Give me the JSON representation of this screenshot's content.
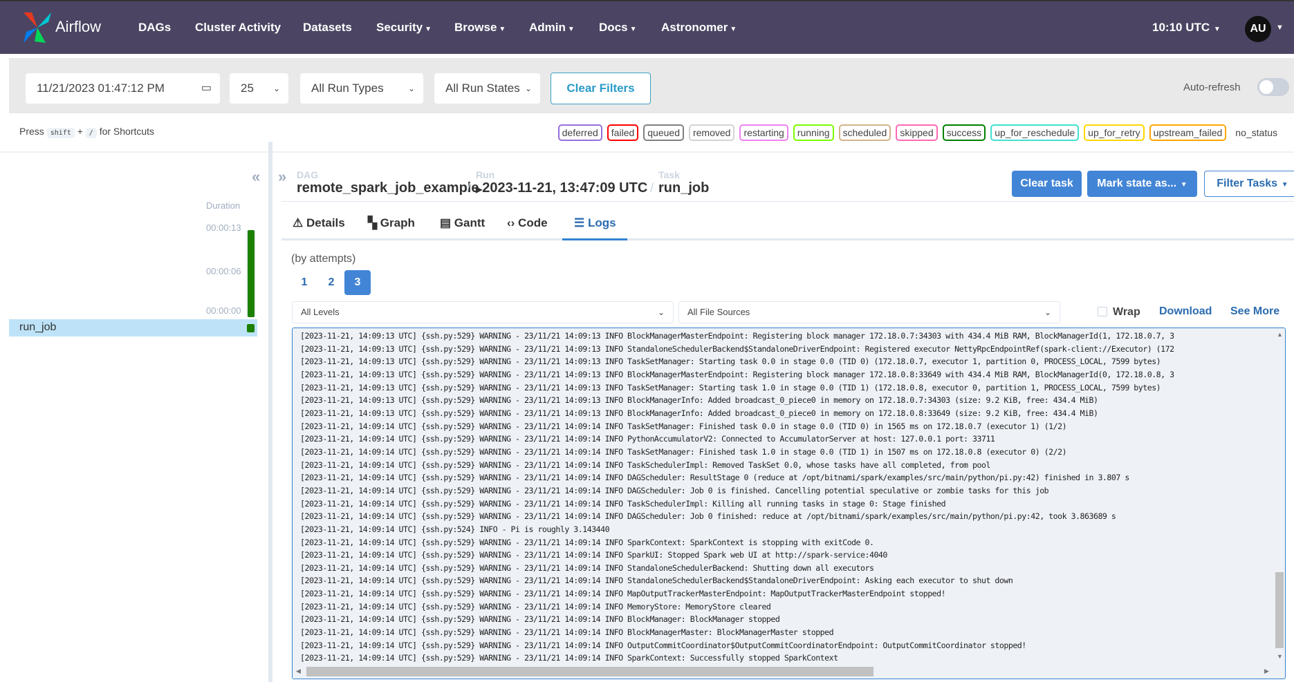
{
  "nav": {
    "brand": "Airflow",
    "items": [
      {
        "label": "DAGs",
        "dropdown": false
      },
      {
        "label": "Cluster Activity",
        "dropdown": false
      },
      {
        "label": "Datasets",
        "dropdown": false
      },
      {
        "label": "Security",
        "dropdown": true
      },
      {
        "label": "Browse",
        "dropdown": true
      },
      {
        "label": "Admin",
        "dropdown": true
      },
      {
        "label": "Docs",
        "dropdown": true
      },
      {
        "label": "Astronomer",
        "dropdown": true
      }
    ],
    "time": "10:10 UTC",
    "avatar": "AU"
  },
  "filters": {
    "datetime": "11/21/2023 01:47:12 PM",
    "limit": "25",
    "run_type": "All Run Types",
    "run_state": "All Run States",
    "clear": "Clear Filters",
    "auto_refresh": "Auto-refresh",
    "auto_refresh_on": false
  },
  "shortcuts": {
    "press": "Press",
    "key1": "shift",
    "plus": "+",
    "key2": "/",
    "suffix": "for Shortcuts"
  },
  "legend": [
    {
      "label": "deferred",
      "color": "#9370db"
    },
    {
      "label": "failed",
      "color": "#ff0000"
    },
    {
      "label": "queued",
      "color": "#808080"
    },
    {
      "label": "removed",
      "color": "#d3d3d3"
    },
    {
      "label": "restarting",
      "color": "#ee82ee"
    },
    {
      "label": "running",
      "color": "#7cfc00"
    },
    {
      "label": "scheduled",
      "color": "#d2b48c"
    },
    {
      "label": "skipped",
      "color": "#ff69b4"
    },
    {
      "label": "success",
      "color": "#008000"
    },
    {
      "label": "up_for_reschedule",
      "color": "#40e0d0"
    },
    {
      "label": "up_for_retry",
      "color": "#ffd700"
    },
    {
      "label": "upstream_failed",
      "color": "#ffa500"
    },
    {
      "label": "no_status",
      "color": ""
    }
  ],
  "grid": {
    "duration_label": "Duration",
    "ticks": [
      "00:00:13",
      "00:00:06",
      "00:00:00"
    ],
    "task": "run_job",
    "status_color": "#1c8000"
  },
  "breadcrumb": {
    "dag_label": "DAG",
    "dag": "remote_spark_job_example",
    "run_label": "Run",
    "run": "2023-11-21, 13:47:09 UTC",
    "task_label": "Task",
    "task": "run_job"
  },
  "actions": {
    "clear_task": "Clear task",
    "mark_state": "Mark state as...",
    "filter_tasks": "Filter Tasks"
  },
  "tabs": [
    {
      "label": "Details",
      "icon": "warning-triangle"
    },
    {
      "label": "Graph",
      "icon": "graph"
    },
    {
      "label": "Gantt",
      "icon": "gantt"
    },
    {
      "label": "Code",
      "icon": "code"
    },
    {
      "label": "Logs",
      "icon": "list",
      "active": true
    }
  ],
  "logs": {
    "attempts_label": "(by attempts)",
    "attempts": [
      "1",
      "2",
      "3"
    ],
    "selected_attempt": "3",
    "level": "All Levels",
    "file_source": "All File Sources",
    "wrap": "Wrap",
    "download": "Download",
    "see_more": "See More",
    "lines": [
      "[2023-11-21, 14:09:13 UTC] {ssh.py:529} WARNING - 23/11/21 14:09:13 INFO BlockManagerMasterEndpoint: Registering block manager 172.18.0.7:34303 with 434.4 MiB RAM, BlockManagerId(1, 172.18.0.7, 3",
      "[2023-11-21, 14:09:13 UTC] {ssh.py:529} WARNING - 23/11/21 14:09:13 INFO StandaloneSchedulerBackend$StandaloneDriverEndpoint: Registered executor NettyRpcEndpointRef(spark-client://Executor) (172",
      "[2023-11-21, 14:09:13 UTC] {ssh.py:529} WARNING - 23/11/21 14:09:13 INFO TaskSetManager: Starting task 0.0 in stage 0.0 (TID 0) (172.18.0.7, executor 1, partition 0, PROCESS_LOCAL, 7599 bytes)",
      "[2023-11-21, 14:09:13 UTC] {ssh.py:529} WARNING - 23/11/21 14:09:13 INFO BlockManagerMasterEndpoint: Registering block manager 172.18.0.8:33649 with 434.4 MiB RAM, BlockManagerId(0, 172.18.0.8, 3",
      "[2023-11-21, 14:09:13 UTC] {ssh.py:529} WARNING - 23/11/21 14:09:13 INFO TaskSetManager: Starting task 1.0 in stage 0.0 (TID 1) (172.18.0.8, executor 0, partition 1, PROCESS_LOCAL, 7599 bytes)",
      "[2023-11-21, 14:09:13 UTC] {ssh.py:529} WARNING - 23/11/21 14:09:13 INFO BlockManagerInfo: Added broadcast_0_piece0 in memory on 172.18.0.7:34303 (size: 9.2 KiB, free: 434.4 MiB)",
      "[2023-11-21, 14:09:13 UTC] {ssh.py:529} WARNING - 23/11/21 14:09:13 INFO BlockManagerInfo: Added broadcast_0_piece0 in memory on 172.18.0.8:33649 (size: 9.2 KiB, free: 434.4 MiB)",
      "[2023-11-21, 14:09:14 UTC] {ssh.py:529} WARNING - 23/11/21 14:09:14 INFO TaskSetManager: Finished task 0.0 in stage 0.0 (TID 0) in 1565 ms on 172.18.0.7 (executor 1) (1/2)",
      "[2023-11-21, 14:09:14 UTC] {ssh.py:529} WARNING - 23/11/21 14:09:14 INFO PythonAccumulatorV2: Connected to AccumulatorServer at host: 127.0.0.1 port: 33711",
      "[2023-11-21, 14:09:14 UTC] {ssh.py:529} WARNING - 23/11/21 14:09:14 INFO TaskSetManager: Finished task 1.0 in stage 0.0 (TID 1) in 1507 ms on 172.18.0.8 (executor 0) (2/2)",
      "[2023-11-21, 14:09:14 UTC] {ssh.py:529} WARNING - 23/11/21 14:09:14 INFO TaskSchedulerImpl: Removed TaskSet 0.0, whose tasks have all completed, from pool",
      "[2023-11-21, 14:09:14 UTC] {ssh.py:529} WARNING - 23/11/21 14:09:14 INFO DAGScheduler: ResultStage 0 (reduce at /opt/bitnami/spark/examples/src/main/python/pi.py:42) finished in 3.807 s",
      "[2023-11-21, 14:09:14 UTC] {ssh.py:529} WARNING - 23/11/21 14:09:14 INFO DAGScheduler: Job 0 is finished. Cancelling potential speculative or zombie tasks for this job",
      "[2023-11-21, 14:09:14 UTC] {ssh.py:529} WARNING - 23/11/21 14:09:14 INFO TaskSchedulerImpl: Killing all running tasks in stage 0: Stage finished",
      "[2023-11-21, 14:09:14 UTC] {ssh.py:529} WARNING - 23/11/21 14:09:14 INFO DAGScheduler: Job 0 finished: reduce at /opt/bitnami/spark/examples/src/main/python/pi.py:42, took 3.863689 s",
      "[2023-11-21, 14:09:14 UTC] {ssh.py:524} INFO - Pi is roughly 3.143440",
      "[2023-11-21, 14:09:14 UTC] {ssh.py:529} WARNING - 23/11/21 14:09:14 INFO SparkContext: SparkContext is stopping with exitCode 0.",
      "[2023-11-21, 14:09:14 UTC] {ssh.py:529} WARNING - 23/11/21 14:09:14 INFO SparkUI: Stopped Spark web UI at http://spark-service:4040",
      "[2023-11-21, 14:09:14 UTC] {ssh.py:529} WARNING - 23/11/21 14:09:14 INFO StandaloneSchedulerBackend: Shutting down all executors",
      "[2023-11-21, 14:09:14 UTC] {ssh.py:529} WARNING - 23/11/21 14:09:14 INFO StandaloneSchedulerBackend$StandaloneDriverEndpoint: Asking each executor to shut down",
      "[2023-11-21, 14:09:14 UTC] {ssh.py:529} WARNING - 23/11/21 14:09:14 INFO MapOutputTrackerMasterEndpoint: MapOutputTrackerMasterEndpoint stopped!",
      "[2023-11-21, 14:09:14 UTC] {ssh.py:529} WARNING - 23/11/21 14:09:14 INFO MemoryStore: MemoryStore cleared",
      "[2023-11-21, 14:09:14 UTC] {ssh.py:529} WARNING - 23/11/21 14:09:14 INFO BlockManager: BlockManager stopped",
      "[2023-11-21, 14:09:14 UTC] {ssh.py:529} WARNING - 23/11/21 14:09:14 INFO BlockManagerMaster: BlockManagerMaster stopped",
      "[2023-11-21, 14:09:14 UTC] {ssh.py:529} WARNING - 23/11/21 14:09:14 INFO OutputCommitCoordinator$OutputCommitCoordinatorEndpoint: OutputCommitCoordinator stopped!",
      "[2023-11-21, 14:09:14 UTC] {ssh.py:529} WARNING - 23/11/21 14:09:14 INFO SparkContext: Successfully stopped SparkContext"
    ]
  }
}
